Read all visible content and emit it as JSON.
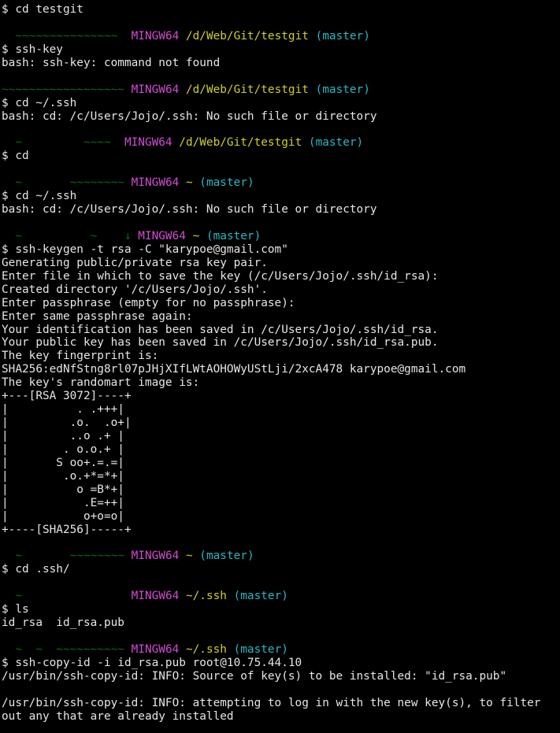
{
  "colors": {
    "background": "#000000",
    "text": "#e6e6e6",
    "user": "#1fbf1f",
    "host": "#d44ad4",
    "path": "#cfcf26",
    "branch": "#26b8c4"
  },
  "terminal": {
    "lines": [
      [
        {
          "c": "text",
          "t": "$ cd testgit"
        }
      ],
      [],
      [
        {
          "c": "user",
          "t": "  ~~~~~~~~~~~~~~~  "
        },
        {
          "c": "host",
          "t": "MINGW64"
        },
        {
          "c": "text",
          "t": " "
        },
        {
          "c": "path",
          "t": "/d/Web/Git/testgit"
        },
        {
          "c": "text",
          "t": " "
        },
        {
          "c": "branch",
          "t": "(master)"
        }
      ],
      [
        {
          "c": "text",
          "t": "$ ssh-key"
        }
      ],
      [
        {
          "c": "text",
          "t": "bash: ssh-key: command not found"
        }
      ],
      [],
      [
        {
          "c": "user",
          "t": "~~~~~~~~~~~~~~~~~~ "
        },
        {
          "c": "host",
          "t": "MINGW64"
        },
        {
          "c": "text",
          "t": " "
        },
        {
          "c": "path",
          "t": "/d/Web/Git/testgit"
        },
        {
          "c": "text",
          "t": " "
        },
        {
          "c": "branch",
          "t": "(master)"
        }
      ],
      [
        {
          "c": "text",
          "t": "$ cd ~/.ssh"
        }
      ],
      [
        {
          "c": "text",
          "t": "bash: cd: /c/Users/Jojo/.ssh: No such file or directory"
        }
      ],
      [],
      [
        {
          "c": "user",
          "t": "  ~         ~~~~  "
        },
        {
          "c": "host",
          "t": "MINGW64"
        },
        {
          "c": "text",
          "t": " "
        },
        {
          "c": "path",
          "t": "/d/Web/Git/testgit"
        },
        {
          "c": "text",
          "t": " "
        },
        {
          "c": "branch",
          "t": "(master)"
        }
      ],
      [
        {
          "c": "text",
          "t": "$ cd"
        }
      ],
      [],
      [
        {
          "c": "user",
          "t": "  ~       ~~~~~~~~ "
        },
        {
          "c": "host",
          "t": "MINGW64"
        },
        {
          "c": "text",
          "t": " "
        },
        {
          "c": "path",
          "t": "~"
        },
        {
          "c": "text",
          "t": " "
        },
        {
          "c": "branch",
          "t": "(master)"
        }
      ],
      [
        {
          "c": "text",
          "t": "$ cd ~/.ssh"
        }
      ],
      [
        {
          "c": "text",
          "t": "bash: cd: /c/Users/Jojo/.ssh: No such file or directory"
        }
      ],
      [],
      [
        {
          "c": "user",
          "t": "  ~          ~    ↓ "
        },
        {
          "c": "host",
          "t": "MINGW64"
        },
        {
          "c": "text",
          "t": " "
        },
        {
          "c": "path",
          "t": "~"
        },
        {
          "c": "text",
          "t": " "
        },
        {
          "c": "branch",
          "t": "(master)"
        }
      ],
      [
        {
          "c": "text",
          "t": "$ ssh-keygen -t rsa -C \"karypoe@gmail.com\""
        }
      ],
      [
        {
          "c": "text",
          "t": "Generating public/private rsa key pair."
        }
      ],
      [
        {
          "c": "text",
          "t": "Enter file in which to save the key (/c/Users/Jojo/.ssh/id_rsa):"
        }
      ],
      [
        {
          "c": "text",
          "t": "Created directory '/c/Users/Jojo/.ssh'."
        }
      ],
      [
        {
          "c": "text",
          "t": "Enter passphrase (empty for no passphrase):"
        }
      ],
      [
        {
          "c": "text",
          "t": "Enter same passphrase again:"
        }
      ],
      [
        {
          "c": "text",
          "t": "Your identification has been saved in /c/Users/Jojo/.ssh/id_rsa."
        }
      ],
      [
        {
          "c": "text",
          "t": "Your public key has been saved in /c/Users/Jojo/.ssh/id_rsa.pub."
        }
      ],
      [
        {
          "c": "text",
          "t": "The key fingerprint is:"
        }
      ],
      [
        {
          "c": "text",
          "t": "SHA256:edNfStng8rl07pJHjXIfLWtAOHOWyUStLji/2xcA478 karypoe@gmail.com"
        }
      ],
      [
        {
          "c": "text",
          "t": "The key's randomart image is:"
        }
      ],
      [
        {
          "c": "text",
          "t": "+---[RSA 3072]----+"
        }
      ],
      [
        {
          "c": "text",
          "t": "|          . .+++|"
        }
      ],
      [
        {
          "c": "text",
          "t": "|         .o.  .o+|"
        }
      ],
      [
        {
          "c": "text",
          "t": "|         ..o .+ |"
        }
      ],
      [
        {
          "c": "text",
          "t": "|        . o.o.+ |"
        }
      ],
      [
        {
          "c": "text",
          "t": "|       S oo+.=.=|"
        }
      ],
      [
        {
          "c": "text",
          "t": "|        .o.+*=*+|"
        }
      ],
      [
        {
          "c": "text",
          "t": "|          o =B*+|"
        }
      ],
      [
        {
          "c": "text",
          "t": "|           .E=++|"
        }
      ],
      [
        {
          "c": "text",
          "t": "|           o+o=o|"
        }
      ],
      [
        {
          "c": "text",
          "t": "+----[SHA256]-----+"
        }
      ],
      [],
      [
        {
          "c": "user",
          "t": "  ~       ~~~~~~~~ "
        },
        {
          "c": "host",
          "t": "MINGW64"
        },
        {
          "c": "text",
          "t": " "
        },
        {
          "c": "path",
          "t": "~"
        },
        {
          "c": "text",
          "t": " "
        },
        {
          "c": "branch",
          "t": "(master)"
        }
      ],
      [
        {
          "c": "text",
          "t": "$ cd .ssh/"
        }
      ],
      [],
      [
        {
          "c": "user",
          "t": "  ~                "
        },
        {
          "c": "host",
          "t": "MINGW64"
        },
        {
          "c": "text",
          "t": " "
        },
        {
          "c": "path",
          "t": "~/.ssh"
        },
        {
          "c": "text",
          "t": " "
        },
        {
          "c": "branch",
          "t": "(master)"
        }
      ],
      [
        {
          "c": "text",
          "t": "$ ls"
        }
      ],
      [
        {
          "c": "text",
          "t": "id_rsa  id_rsa.pub"
        }
      ],
      [],
      [
        {
          "c": "user",
          "t": "  ~  ~  ~~~~~~~~~~ "
        },
        {
          "c": "host",
          "t": "MINGW64"
        },
        {
          "c": "text",
          "t": " "
        },
        {
          "c": "path",
          "t": "~/.ssh"
        },
        {
          "c": "text",
          "t": " "
        },
        {
          "c": "branch",
          "t": "(master)"
        }
      ],
      [
        {
          "c": "text",
          "t": "$ ssh-copy-id -i id_rsa.pub root@10.75.44.10"
        }
      ],
      [
        {
          "c": "text",
          "t": "/usr/bin/ssh-copy-id: INFO: Source of key(s) to be installed: \"id_rsa.pub\""
        }
      ],
      [],
      [
        {
          "c": "text",
          "t": "/usr/bin/ssh-copy-id: INFO: attempting to log in with the new key(s), to filter"
        }
      ],
      [
        {
          "c": "text",
          "t": "out any that are already installed"
        }
      ]
    ]
  }
}
